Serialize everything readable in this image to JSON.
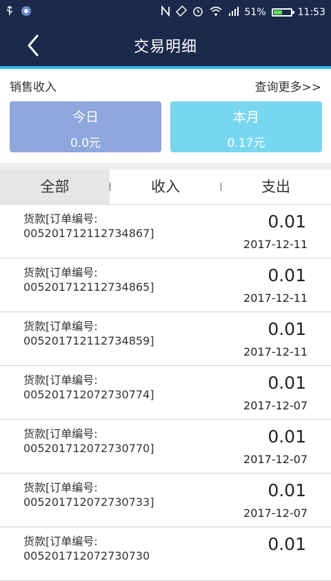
{
  "status_bar": {
    "left_icons": [
      "usb-icon",
      "app-notification-icon"
    ],
    "right_icons": [
      "nfc-icon",
      "rotation-icon",
      "alarm-icon",
      "wifi-icon",
      "signal-icon"
    ],
    "battery_percent": "51%",
    "battery_level": 0.51,
    "time": "11:53"
  },
  "header": {
    "back_icon": "chevron-left-icon",
    "title": "交易明细"
  },
  "summary": {
    "label": "销售收入",
    "more_link": "查询更多>>",
    "today": {
      "label": "今日",
      "value": "0.0元"
    },
    "month": {
      "label": "本月",
      "value": "0.17元"
    }
  },
  "tabs": [
    {
      "label": "全部",
      "selected": true
    },
    {
      "label": "收入",
      "selected": false
    },
    {
      "label": "支出",
      "selected": false
    }
  ],
  "transactions": [
    {
      "desc_line1": "货款[订单编号:",
      "desc_line2": "005201712112734867]",
      "amount": "0.01",
      "date": "2017-12-11"
    },
    {
      "desc_line1": "货款[订单编号:",
      "desc_line2": "005201712112734865]",
      "amount": "0.01",
      "date": "2017-12-11"
    },
    {
      "desc_line1": "货款[订单编号:",
      "desc_line2": "005201712112734859]",
      "amount": "0.01",
      "date": "2017-12-11"
    },
    {
      "desc_line1": "货款[订单编号:",
      "desc_line2": "005201712072730774]",
      "amount": "0.01",
      "date": "2017-12-07"
    },
    {
      "desc_line1": "货款[订单编号:",
      "desc_line2": "005201712072730770]",
      "amount": "0.01",
      "date": "2017-12-07"
    },
    {
      "desc_line1": "货款[订单编号:",
      "desc_line2": "005201712072730733]",
      "amount": "0.01",
      "date": "2017-12-07"
    },
    {
      "desc_line1": "货款[订单编号:",
      "desc_line2": "005201712072730730",
      "amount": "0.01",
      "date": ""
    }
  ],
  "colors": {
    "header_bg": "#1b2a4b",
    "accent": "#2fb9e6",
    "today_card": "#8ea7dc",
    "month_card": "#78d7ef"
  }
}
